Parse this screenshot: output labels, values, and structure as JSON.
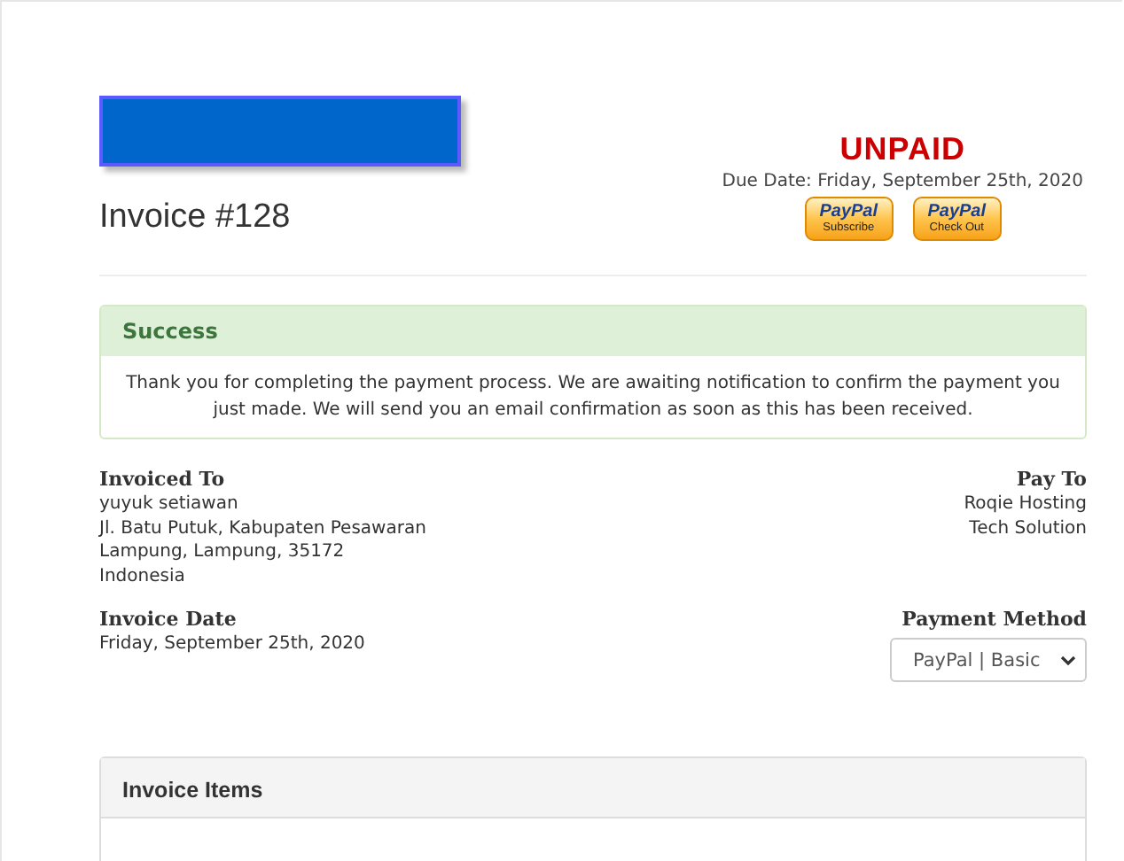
{
  "invoice": {
    "title": "Invoice #128",
    "status": "UNPAID",
    "due_date": "Due Date: Friday, September 25th, 2020"
  },
  "paypal_buttons": [
    {
      "brand": "PayPal",
      "label": "Subscribe"
    },
    {
      "brand": "PayPal",
      "label": "Check Out"
    }
  ],
  "alert": {
    "title": "Success",
    "message": "Thank you for completing the payment process. We are awaiting notification to confirm the payment you just made. We will send you an email confirmation as soon as this has been received."
  },
  "invoiced_to": {
    "heading": "Invoiced To",
    "lines": [
      "yuyuk setiawan",
      "Jl. Batu Putuk, Kabupaten Pesawaran",
      "Lampung, Lampung, 35172",
      "Indonesia"
    ]
  },
  "pay_to": {
    "heading": "Pay To",
    "lines": [
      "Roqie Hosting",
      "Tech Solution"
    ]
  },
  "invoice_date": {
    "heading": "Invoice Date",
    "value": "Friday, September 25th, 2020"
  },
  "payment_method": {
    "heading": "Payment Method",
    "value": "PayPal | Basic"
  },
  "items_panel": {
    "title": "Invoice Items"
  }
}
